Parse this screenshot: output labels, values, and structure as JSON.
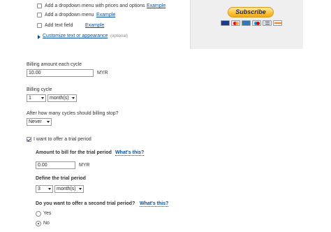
{
  "top_options": {
    "dropdown_prices_label": "Add a dropdown menu with prices and options",
    "dropdown_prices_example": "Example",
    "dropdown_label": "Add a dropdown menu",
    "dropdown_example": "Example",
    "text_field_label": "Add text field",
    "text_field_example": "Example",
    "customize_link": "Customize text or appearance",
    "customize_optional": "(optional)"
  },
  "preview": {
    "subscribe_label": "Subscribe",
    "cards": [
      "visa-card-icon",
      "mastercard-icon",
      "amex-card-icon",
      "maestro-card-icon",
      "bank-icon",
      "discover-card-icon"
    ]
  },
  "billing": {
    "amount_label": "Billing amount each cycle",
    "amount_value": "10.00",
    "currency": "MYR",
    "cycle_label": "Billing cycle",
    "cycle_number": "1",
    "cycle_unit": "month(s)",
    "stop_label": "After how many cycles should billing stop?",
    "stop_value": "Never"
  },
  "trial": {
    "offer_label": "I want to offer a trial period",
    "amount_label": "Amount to bill for the trial period",
    "help_text": "What's this?",
    "amount_value": "0.00",
    "currency": "MYR",
    "define_label": "Define the trial period",
    "period_number": "3",
    "period_unit": "month(s)",
    "second_label": "Do you want to offer a second trial period?",
    "second_help": "What's this?",
    "option_yes": "Yes",
    "option_no": "No"
  }
}
